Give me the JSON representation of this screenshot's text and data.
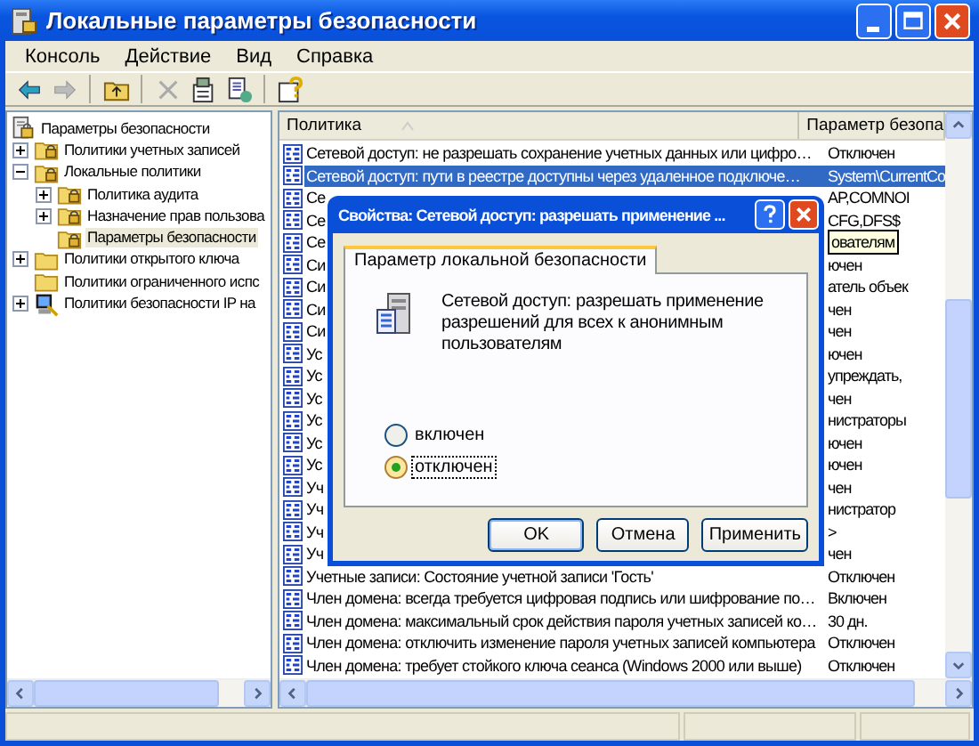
{
  "window": {
    "title": "Локальные параметры безопасности"
  },
  "menu": [
    "Консоль",
    "Действие",
    "Вид",
    "Справка"
  ],
  "toolbar": [
    {
      "disabled": false
    },
    {
      "disabled": true
    },
    {
      "disabled": false
    },
    {
      "disabled": true
    },
    {
      "disabled": false
    },
    {
      "disabled": false
    },
    {
      "disabled": false
    }
  ],
  "tree": {
    "label": "Параметры безопасности",
    "children": [
      {
        "label": "Политики учетных записей",
        "kind": "secure-folder",
        "expandable": true,
        "expanded": false,
        "selected": false
      },
      {
        "label": "Локальные политики",
        "kind": "secure-folder",
        "expandable": true,
        "expanded": true,
        "selected": false,
        "children": [
          {
            "label": "Политика аудита",
            "kind": "secure-folder",
            "expandable": true,
            "expanded": false,
            "selected": false
          },
          {
            "label": "Назначение прав пользова",
            "kind": "secure-folder",
            "expandable": true,
            "expanded": false,
            "selected": false
          },
          {
            "label": "Параметры безопасности",
            "kind": "secure-folder",
            "expandable": false,
            "selected": true
          }
        ]
      },
      {
        "label": "Политики открытого ключа",
        "kind": "folder",
        "expandable": true,
        "expanded": false,
        "selected": false
      },
      {
        "label": "Политики ограниченного испс",
        "kind": "folder",
        "expandable": false,
        "selected": false
      },
      {
        "label": "Политики безопасности IP на",
        "kind": "ip-policy",
        "expandable": true,
        "expanded": false,
        "selected": false
      }
    ]
  },
  "table": {
    "columns": [
      "Политика",
      "Параметр безопа"
    ],
    "rows": [
      {
        "policy": "Сетевой доступ: не разрешать сохранение учетных данных или цифро…",
        "value": "Отключен",
        "selected": false
      },
      {
        "policy": "Сетевой доступ: пути в реестре доступны через удаленное подключе…",
        "value": "System\\CurrentCo",
        "selected": true
      },
      {
        "policy": "Се",
        "value": "AP,COMNOI",
        "selected": false
      },
      {
        "policy": "Се",
        "value": "CFG,DFS$",
        "selected": false
      },
      {
        "policy": "Се",
        "value": "ователям",
        "value_boxed": true,
        "selected": false
      },
      {
        "policy": "Си",
        "value": "ючен",
        "selected": false
      },
      {
        "policy": "Си",
        "value": "атель объек",
        "selected": false
      },
      {
        "policy": "Си",
        "value": "чен",
        "selected": false
      },
      {
        "policy": "Си",
        "value": "чен",
        "selected": false
      },
      {
        "policy": "Ус",
        "value": "ючен",
        "selected": false
      },
      {
        "policy": "Ус",
        "value": "упреждать,",
        "selected": false
      },
      {
        "policy": "Ус",
        "value": "чен",
        "selected": false
      },
      {
        "policy": "Ус",
        "value": "нистраторы",
        "selected": false
      },
      {
        "policy": "Ус",
        "value": "ючен",
        "selected": false
      },
      {
        "policy": "Ус",
        "value": "ючен",
        "selected": false
      },
      {
        "policy": "Уч",
        "value": "чен",
        "selected": false
      },
      {
        "policy": "Уч",
        "value": "нистратор",
        "selected": false
      },
      {
        "policy": "Уч",
        "value": ">",
        "selected": false
      },
      {
        "policy": "Уч",
        "value": "чен",
        "selected": false
      },
      {
        "policy": "Учетные записи: Состояние учетной записи 'Гость'",
        "value": "Отключен",
        "selected": false
      },
      {
        "policy": "Член домена: всегда требуется цифровая подпись или шифрование по…",
        "value": "Включен",
        "selected": false
      },
      {
        "policy": "Член домена: максимальный срок действия пароля учетных записей ко…",
        "value": "30 дн.",
        "selected": false
      },
      {
        "policy": "Член домена: отключить изменение пароля учетных записей компьютера",
        "value": "Отключен",
        "selected": false
      },
      {
        "policy": "Член домена: требует стойкого ключа сеанса (Windows 2000 или выше)",
        "value": "Отключен",
        "selected": false
      }
    ]
  },
  "dialog": {
    "title": "Свойства: Сетевой доступ: разрешать применение ...",
    "tab": "Параметр локальной безопасности",
    "description": "Сетевой доступ: разрешать применение разрешений для всех к анонимным пользователям",
    "options": [
      {
        "label": "включен",
        "selected": false
      },
      {
        "label": "отключен",
        "selected": true
      }
    ],
    "buttons": [
      "OK",
      "Отмена",
      "Применить"
    ]
  }
}
